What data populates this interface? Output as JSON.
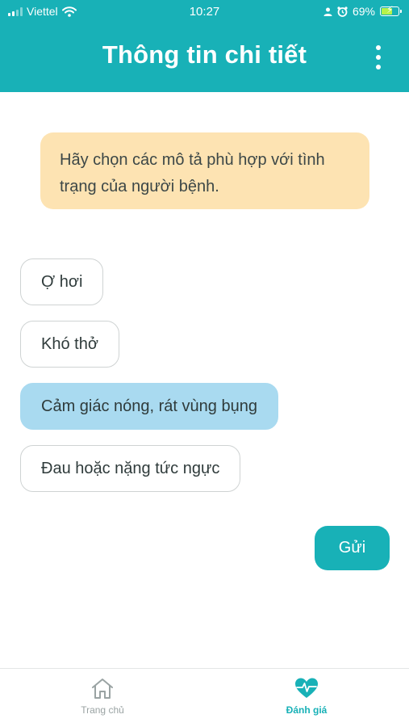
{
  "status_bar": {
    "carrier": "Viettel",
    "time": "10:27",
    "battery_percent": "69%",
    "battery_level": 0.69,
    "icons": [
      "signal-icon",
      "wifi-icon",
      "person-icon",
      "alarm-icon",
      "battery-icon"
    ]
  },
  "header": {
    "title": "Thông tin chi tiết",
    "menu_icon": "more-vertical-icon"
  },
  "notice": {
    "text": "Hãy chọn các mô tả phù hợp với tình trạng của người bệnh."
  },
  "options": [
    {
      "label": "Ợ hơi",
      "selected": false
    },
    {
      "label": "Khó thở",
      "selected": false
    },
    {
      "label": "Cảm giác nóng, rát vùng bụng",
      "selected": true
    },
    {
      "label": "Đau hoặc nặng tức ngực",
      "selected": false
    }
  ],
  "actions": {
    "send_label": "Gửi"
  },
  "tabbar": {
    "items": [
      {
        "label": "Trang chủ",
        "icon": "home-icon",
        "active": false
      },
      {
        "label": "Đánh giá",
        "icon": "heart-pulse-icon",
        "active": true
      }
    ]
  },
  "colors": {
    "primary": "#18b1b7",
    "notice_bg": "#fde3b2",
    "selected_bg": "#a9daf0"
  }
}
